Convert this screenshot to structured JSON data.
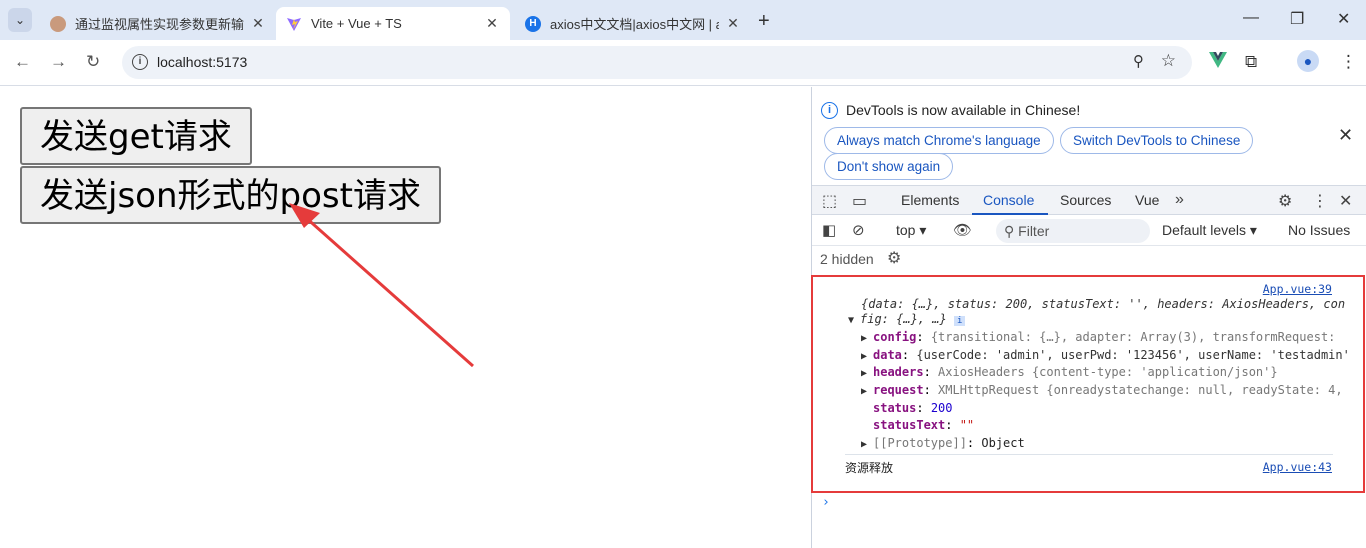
{
  "browser": {
    "tabs": [
      {
        "title": "通过监视属性实现参数更新输出",
        "close": "✕"
      },
      {
        "title": "Vite + Vue + TS",
        "close": "✕"
      },
      {
        "title": "axios中文文档|axios中文网 | ax",
        "close": "✕"
      }
    ],
    "new_tab": "+",
    "url": "localhost:5173"
  },
  "page": {
    "get_button": "发送get请求",
    "post_button": "发送json形式的post请求"
  },
  "devtools": {
    "info_message": "DevTools is now available in Chinese!",
    "match_language": "Always match Chrome's language",
    "switch_language": "Switch DevTools to Chinese",
    "dont_show": "Don't show again",
    "tabs": [
      "Elements",
      "Console",
      "Sources",
      "Vue"
    ],
    "active_tab": "Console",
    "context": "top",
    "filter_placeholder": "Filter",
    "levels": "Default levels",
    "issues": "No Issues",
    "hidden_count": "2 hidden"
  },
  "console": {
    "entry1_source": "App.vue:39",
    "summary_line1": "{data: {…}, status: 200, statusText: '', headers: AxiosHeaders, con",
    "summary_line2": "fig: {…}, …}",
    "props": [
      {
        "key": "config",
        "value": "{transitional: {…}, adapter: Array(3), transformRequest:"
      },
      {
        "key": "data",
        "value": "{userCode: 'admin', userPwd: '123456', userName: 'testadmin'"
      },
      {
        "key": "headers",
        "value": "AxiosHeaders {content-type: 'application/json'}"
      },
      {
        "key": "request",
        "value": "XMLHttpRequest {onreadystatechange: null, readyState: 4,"
      },
      {
        "key": "status",
        "value": "200"
      },
      {
        "key": "statusText",
        "value": "\"\""
      },
      {
        "key": "[[Prototype]]",
        "value": "Object"
      }
    ],
    "entry2_text": "资源释放",
    "entry2_source": "App.vue:43"
  },
  "colors": {
    "highlight_box": "#e53b3b",
    "annotation_arrow": "#e53b3b",
    "link_blue": "#1a56c0"
  }
}
